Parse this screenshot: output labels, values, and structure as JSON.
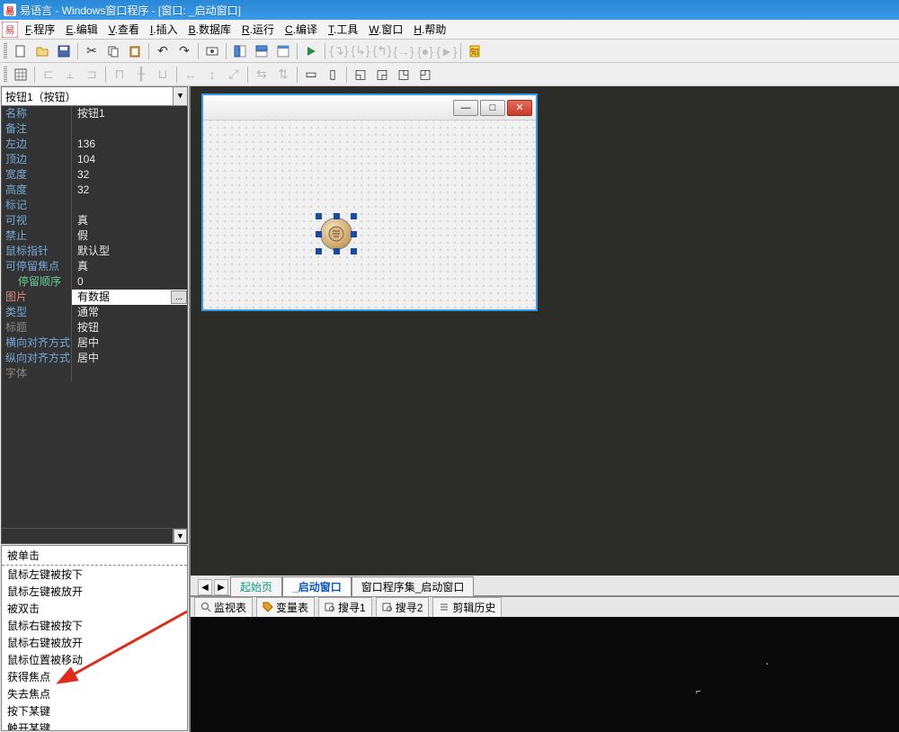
{
  "title": "易语言 - Windows窗口程序 - [窗口: _启动窗口]",
  "menu": {
    "program": {
      "ul": "F",
      "rest": ".程序"
    },
    "edit": {
      "ul": "E",
      "rest": ".编辑"
    },
    "search": {
      "ul": "V",
      "rest": ".查看"
    },
    "insert": {
      "ul": "I",
      "rest": ".插入"
    },
    "database": {
      "ul": "B",
      "rest": ".数据库"
    },
    "run": {
      "ul": "R",
      "rest": ".运行"
    },
    "compile": {
      "ul": "C",
      "rest": ".编译"
    },
    "tools": {
      "ul": "T",
      "rest": ".工具"
    },
    "window": {
      "ul": "W",
      "rest": ".窗口"
    },
    "help": {
      "ul": "H",
      "rest": ".帮助"
    }
  },
  "selector": {
    "value": "按钮1（按钮）"
  },
  "props": [
    {
      "k": "名称",
      "v": "按钮1",
      "kc": "norm"
    },
    {
      "k": "备注",
      "v": "",
      "kc": "norm"
    },
    {
      "k": "左边",
      "v": "136",
      "kc": "norm"
    },
    {
      "k": "顶边",
      "v": "104",
      "kc": "norm"
    },
    {
      "k": "宽度",
      "v": "32",
      "kc": "norm"
    },
    {
      "k": "高度",
      "v": "32",
      "kc": "norm"
    },
    {
      "k": "标记",
      "v": "",
      "kc": "norm"
    },
    {
      "k": "可视",
      "v": "真",
      "kc": "norm"
    },
    {
      "k": "禁止",
      "v": "假",
      "kc": "norm"
    },
    {
      "k": "鼠标指针",
      "v": "默认型",
      "kc": "norm"
    },
    {
      "k": "可停留焦点",
      "v": "真",
      "kc": "norm"
    },
    {
      "k": "停留顺序",
      "v": "0",
      "kc": "indent"
    },
    {
      "k": "图片",
      "v": "有数据",
      "kc": "highlight",
      "editing": true
    },
    {
      "k": "类型",
      "v": "通常",
      "kc": "norm"
    },
    {
      "k": "标题",
      "v": "按钮",
      "kc": "greyed"
    },
    {
      "k": "横向对齐方式",
      "v": "居中",
      "kc": "norm"
    },
    {
      "k": "纵向对齐方式",
      "v": "居中",
      "kc": "norm"
    },
    {
      "k": "字体",
      "v": "",
      "kc": "greyed"
    }
  ],
  "events": {
    "header": "被单击",
    "items": [
      "鼠标左键被按下",
      "鼠标左键被放开",
      "被双击",
      "鼠标右键被按下",
      "鼠标右键被放开",
      "鼠标位置被移动",
      "获得焦点",
      "失去焦点",
      "按下某键",
      "触开某键"
    ]
  },
  "docTabs": {
    "start": "起始页",
    "window": "_启动窗口",
    "codeset": "窗口程序集_启动窗口"
  },
  "dockTabs": {
    "watch": "监视表",
    "vars": "变量表",
    "find1": "搜寻1",
    "find2": "搜寻2",
    "clip": "剪辑历史"
  },
  "ellipsis": "..."
}
